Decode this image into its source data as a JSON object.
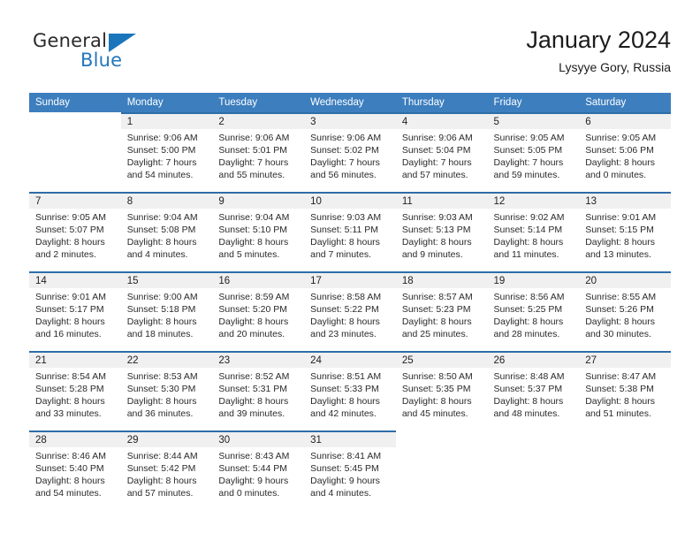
{
  "brand": {
    "name_top": "General",
    "name_bottom": "Blue",
    "accent_color": "#2477bb"
  },
  "header": {
    "title": "January 2024",
    "location": "Lysyye Gory, Russia"
  },
  "theme": {
    "header_row_bg": "#3c7ebe",
    "day_band_bg": "#f0f0f0",
    "separator_color": "#2e6da8"
  },
  "weekdays": [
    "Sunday",
    "Monday",
    "Tuesday",
    "Wednesday",
    "Thursday",
    "Friday",
    "Saturday"
  ],
  "weeks": [
    [
      {
        "day": "",
        "sunrise": "",
        "sunset": "",
        "daylight": ""
      },
      {
        "day": "1",
        "sunrise": "Sunrise: 9:06 AM",
        "sunset": "Sunset: 5:00 PM",
        "daylight": "Daylight: 7 hours and 54 minutes."
      },
      {
        "day": "2",
        "sunrise": "Sunrise: 9:06 AM",
        "sunset": "Sunset: 5:01 PM",
        "daylight": "Daylight: 7 hours and 55 minutes."
      },
      {
        "day": "3",
        "sunrise": "Sunrise: 9:06 AM",
        "sunset": "Sunset: 5:02 PM",
        "daylight": "Daylight: 7 hours and 56 minutes."
      },
      {
        "day": "4",
        "sunrise": "Sunrise: 9:06 AM",
        "sunset": "Sunset: 5:04 PM",
        "daylight": "Daylight: 7 hours and 57 minutes."
      },
      {
        "day": "5",
        "sunrise": "Sunrise: 9:05 AM",
        "sunset": "Sunset: 5:05 PM",
        "daylight": "Daylight: 7 hours and 59 minutes."
      },
      {
        "day": "6",
        "sunrise": "Sunrise: 9:05 AM",
        "sunset": "Sunset: 5:06 PM",
        "daylight": "Daylight: 8 hours and 0 minutes."
      }
    ],
    [
      {
        "day": "7",
        "sunrise": "Sunrise: 9:05 AM",
        "sunset": "Sunset: 5:07 PM",
        "daylight": "Daylight: 8 hours and 2 minutes."
      },
      {
        "day": "8",
        "sunrise": "Sunrise: 9:04 AM",
        "sunset": "Sunset: 5:08 PM",
        "daylight": "Daylight: 8 hours and 4 minutes."
      },
      {
        "day": "9",
        "sunrise": "Sunrise: 9:04 AM",
        "sunset": "Sunset: 5:10 PM",
        "daylight": "Daylight: 8 hours and 5 minutes."
      },
      {
        "day": "10",
        "sunrise": "Sunrise: 9:03 AM",
        "sunset": "Sunset: 5:11 PM",
        "daylight": "Daylight: 8 hours and 7 minutes."
      },
      {
        "day": "11",
        "sunrise": "Sunrise: 9:03 AM",
        "sunset": "Sunset: 5:13 PM",
        "daylight": "Daylight: 8 hours and 9 minutes."
      },
      {
        "day": "12",
        "sunrise": "Sunrise: 9:02 AM",
        "sunset": "Sunset: 5:14 PM",
        "daylight": "Daylight: 8 hours and 11 minutes."
      },
      {
        "day": "13",
        "sunrise": "Sunrise: 9:01 AM",
        "sunset": "Sunset: 5:15 PM",
        "daylight": "Daylight: 8 hours and 13 minutes."
      }
    ],
    [
      {
        "day": "14",
        "sunrise": "Sunrise: 9:01 AM",
        "sunset": "Sunset: 5:17 PM",
        "daylight": "Daylight: 8 hours and 16 minutes."
      },
      {
        "day": "15",
        "sunrise": "Sunrise: 9:00 AM",
        "sunset": "Sunset: 5:18 PM",
        "daylight": "Daylight: 8 hours and 18 minutes."
      },
      {
        "day": "16",
        "sunrise": "Sunrise: 8:59 AM",
        "sunset": "Sunset: 5:20 PM",
        "daylight": "Daylight: 8 hours and 20 minutes."
      },
      {
        "day": "17",
        "sunrise": "Sunrise: 8:58 AM",
        "sunset": "Sunset: 5:22 PM",
        "daylight": "Daylight: 8 hours and 23 minutes."
      },
      {
        "day": "18",
        "sunrise": "Sunrise: 8:57 AM",
        "sunset": "Sunset: 5:23 PM",
        "daylight": "Daylight: 8 hours and 25 minutes."
      },
      {
        "day": "19",
        "sunrise": "Sunrise: 8:56 AM",
        "sunset": "Sunset: 5:25 PM",
        "daylight": "Daylight: 8 hours and 28 minutes."
      },
      {
        "day": "20",
        "sunrise": "Sunrise: 8:55 AM",
        "sunset": "Sunset: 5:26 PM",
        "daylight": "Daylight: 8 hours and 30 minutes."
      }
    ],
    [
      {
        "day": "21",
        "sunrise": "Sunrise: 8:54 AM",
        "sunset": "Sunset: 5:28 PM",
        "daylight": "Daylight: 8 hours and 33 minutes."
      },
      {
        "day": "22",
        "sunrise": "Sunrise: 8:53 AM",
        "sunset": "Sunset: 5:30 PM",
        "daylight": "Daylight: 8 hours and 36 minutes."
      },
      {
        "day": "23",
        "sunrise": "Sunrise: 8:52 AM",
        "sunset": "Sunset: 5:31 PM",
        "daylight": "Daylight: 8 hours and 39 minutes."
      },
      {
        "day": "24",
        "sunrise": "Sunrise: 8:51 AM",
        "sunset": "Sunset: 5:33 PM",
        "daylight": "Daylight: 8 hours and 42 minutes."
      },
      {
        "day": "25",
        "sunrise": "Sunrise: 8:50 AM",
        "sunset": "Sunset: 5:35 PM",
        "daylight": "Daylight: 8 hours and 45 minutes."
      },
      {
        "day": "26",
        "sunrise": "Sunrise: 8:48 AM",
        "sunset": "Sunset: 5:37 PM",
        "daylight": "Daylight: 8 hours and 48 minutes."
      },
      {
        "day": "27",
        "sunrise": "Sunrise: 8:47 AM",
        "sunset": "Sunset: 5:38 PM",
        "daylight": "Daylight: 8 hours and 51 minutes."
      }
    ],
    [
      {
        "day": "28",
        "sunrise": "Sunrise: 8:46 AM",
        "sunset": "Sunset: 5:40 PM",
        "daylight": "Daylight: 8 hours and 54 minutes."
      },
      {
        "day": "29",
        "sunrise": "Sunrise: 8:44 AM",
        "sunset": "Sunset: 5:42 PM",
        "daylight": "Daylight: 8 hours and 57 minutes."
      },
      {
        "day": "30",
        "sunrise": "Sunrise: 8:43 AM",
        "sunset": "Sunset: 5:44 PM",
        "daylight": "Daylight: 9 hours and 0 minutes."
      },
      {
        "day": "31",
        "sunrise": "Sunrise: 8:41 AM",
        "sunset": "Sunset: 5:45 PM",
        "daylight": "Daylight: 9 hours and 4 minutes."
      },
      {
        "day": "",
        "sunrise": "",
        "sunset": "",
        "daylight": ""
      },
      {
        "day": "",
        "sunrise": "",
        "sunset": "",
        "daylight": ""
      },
      {
        "day": "",
        "sunrise": "",
        "sunset": "",
        "daylight": ""
      }
    ]
  ]
}
